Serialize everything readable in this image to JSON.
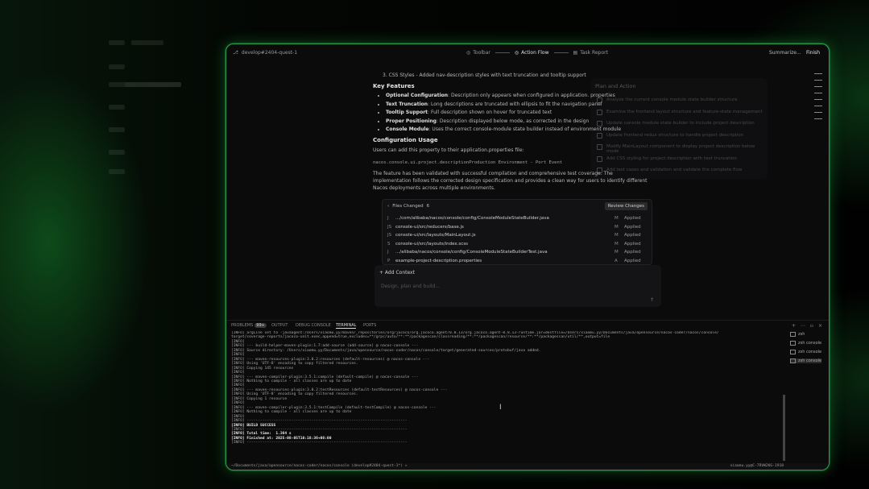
{
  "titlebar": {
    "branch": "develop#2404-quest-1",
    "steps": [
      "Toolbar",
      "Action Flow",
      "Task Report"
    ],
    "summarize": "Summarize...",
    "finish": "Finish"
  },
  "chat": {
    "line0": "3. CSS Styles - Added nav-description styles with text truncation and tooltip support",
    "features_heading": "Key Features",
    "features": [
      {
        "b": "Optional Configuration",
        "t": ": Description only appears when configured in application. properties"
      },
      {
        "b": "Text Truncation",
        "t": ": Long descriptions are truncated with ellipsis to fit the navigation panel"
      },
      {
        "b": "Tooltip Support",
        "t": ": Full description shown on hover for truncated text"
      },
      {
        "b": "Proper Positioning",
        "t": ": Description displayed below mode, as corrected in the design"
      },
      {
        "b": "Console Module",
        "t": ": Uses the correct console-module state builder instead of environment module"
      }
    ],
    "config_heading": "Configuration Usage",
    "config_text": "Users can add this property to their application.properties file:",
    "config_code": "nacos.console.ui.project.descriptionProduction Environment - Port Event",
    "validated": "The feature has been validated with successful compilation and comprehensive test coverage. The implementation follows the corrected design specification and provides a clean way for users to identify different Nacos deployments across multiple environments."
  },
  "plan": {
    "title": "Plan and Action",
    "items": [
      "Analyze the current console module state builder structure",
      "Examine the frontend layout structure and feature-state management",
      "Update console module state builder to include project description",
      "Update frontend redux structure to handle project description",
      "Modify MainLayout component to display project description below mode",
      "Add CSS styling for project description with text truncation",
      "Add test cases and validation and validate the complete flow"
    ]
  },
  "files": {
    "header": "Files Changed",
    "count": "6",
    "review": "Review Changes",
    "rows": [
      {
        "icon": "J",
        "name": ".../com/alibaba/nacos/console/config/ConsoleModuleStateBuilder.java",
        "m": "M",
        "status": "Applied"
      },
      {
        "icon": "JS",
        "name": "console-ui/src/reducers/base.js",
        "m": "M",
        "status": "Applied"
      },
      {
        "icon": "JS",
        "name": "console-ui/src/layouts/MainLayout.js",
        "m": "M",
        "status": "Applied"
      },
      {
        "icon": "S",
        "name": "console-ui/src/layouts/index.scss",
        "m": "M",
        "status": "Applied"
      },
      {
        "icon": "J",
        "name": ".../alibaba/nacos/console/config/ConsoleModuleStateBuilderTest.java",
        "m": "M",
        "status": "Applied"
      },
      {
        "icon": "P",
        "name": "example-project-description.properties",
        "m": "A",
        "status": "Applied"
      }
    ]
  },
  "context": {
    "add": "+ Add Context",
    "placeholder": "Design, plan and build..."
  },
  "panel": {
    "tabs": [
      "PROBLEMS",
      "OUTPUT",
      "DEBUG CONSOLE",
      "TERMINAL",
      "PORTS"
    ],
    "problems_badge": "99+"
  },
  "terminal": {
    "lines": [
      "[INFO] argLine set to -javaagent:/Users/xiaomu.yy/maven/_repositories/org/jacoco/org.jacoco.agent/0.8.13/org.jacoco.agent-0.8.13-runtime.jar=destfile=/Users/xiaomu.yy/Documents/java/opensource/nacos-coder/nacos/console/",
      "target/coverage-reports/jacoco-unit.exec,append=true,excludes=**/grpc/auto/**:**/packagescan/classreading/**:**/packagescan/resource/**:**/packagescan/util/**,output=file",
      "[INFO]",
      "[INFO] --- build-helper-maven-plugin:1.7:add-source (add-source) @ nacos-console ---",
      "[INFO] Source directory: /Users/xiaomu.yy/Documents/java/opensource/nacos-coder/nacos/console/target/generated-sources/protobuf/java added.",
      "[INFO]",
      "[INFO] --- maven-resources-plugin:3.0.2:resources (default-resources) @ nacos-console ---",
      "[INFO] Using 'UTF-8' encoding to copy filtered resources.",
      "[INFO] Copying 145 resources",
      "[INFO]",
      "[INFO] --- maven-compiler-plugin:3.5.1:compile (default-compile) @ nacos-console ---",
      "[INFO] Nothing to compile - all classes are up to date",
      "[INFO]",
      "[INFO] --- maven-resources-plugin:3.0.2:testResources (default-testResources) @ nacos-console ---",
      "[INFO] Using 'UTF-8' encoding to copy filtered resources.",
      "[INFO] Copying 1 resource",
      "[INFO]",
      "[INFO] --- maven-compiler-plugin:3.5.1:testCompile (default-testCompile) @ nacos-console ---",
      "[INFO] Nothing to compile - all classes are up to date",
      "[INFO]",
      "[INFO] ------------------------------------------------------------------------",
      "[INFO] BUILD SUCCESS",
      "[INFO] ------------------------------------------------------------------------",
      "[INFO] Total time:  1.364 s",
      "[INFO] Finished at: 2025-08-05T10:18:36+08:00",
      "[INFO] ------------------------------------------------------------------------"
    ],
    "sessions": [
      {
        "label": "zsh",
        "active": false
      },
      {
        "label": "zsh console",
        "active": false
      },
      {
        "label": "zsh console",
        "active": false
      },
      {
        "label": "zsh console",
        "active": true
      }
    ]
  },
  "statusbar": {
    "left": "~/Documents/java/opensource/nacos-coder/nacos/console (develop#2404-quest-1*) »",
    "right": "xiaomu.yy@C-7RVW2KG-1918"
  }
}
